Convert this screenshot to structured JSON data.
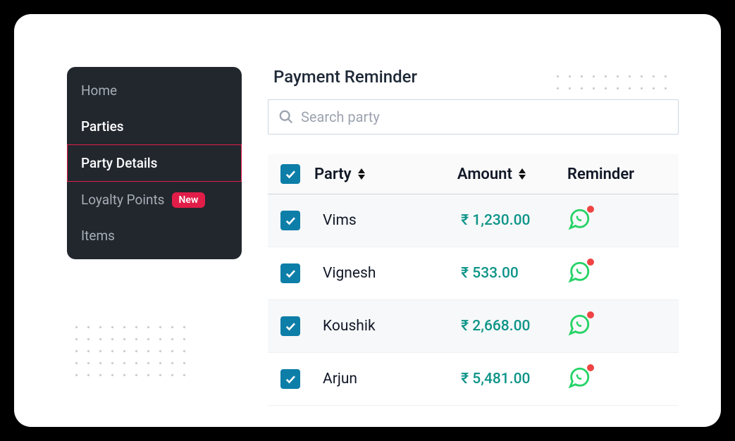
{
  "sidebar": {
    "items": [
      {
        "label": "Home"
      },
      {
        "label": "Parties"
      },
      {
        "label": "Party Details"
      },
      {
        "label": "Loyalty Points",
        "badge": "New"
      },
      {
        "label": "Items"
      }
    ]
  },
  "page": {
    "title": "Payment Reminder"
  },
  "search": {
    "placeholder": "Search party"
  },
  "table": {
    "headers": {
      "party": "Party",
      "amount": "Amount",
      "reminder": "Reminder"
    },
    "rows": [
      {
        "party": "Vims",
        "amount": "₹ 1,230.00",
        "checked": true
      },
      {
        "party": "Vignesh",
        "amount": "₹ 533.00",
        "checked": true
      },
      {
        "party": "Koushik",
        "amount": "₹ 2,668.00",
        "checked": true
      },
      {
        "party": "Arjun",
        "amount": "₹ 5,481.00",
        "checked": true
      }
    ]
  },
  "colors": {
    "accent": "#0d7ea8",
    "danger": "#e11d48",
    "teal": "#0d9488",
    "whatsapp": "#25d366"
  }
}
